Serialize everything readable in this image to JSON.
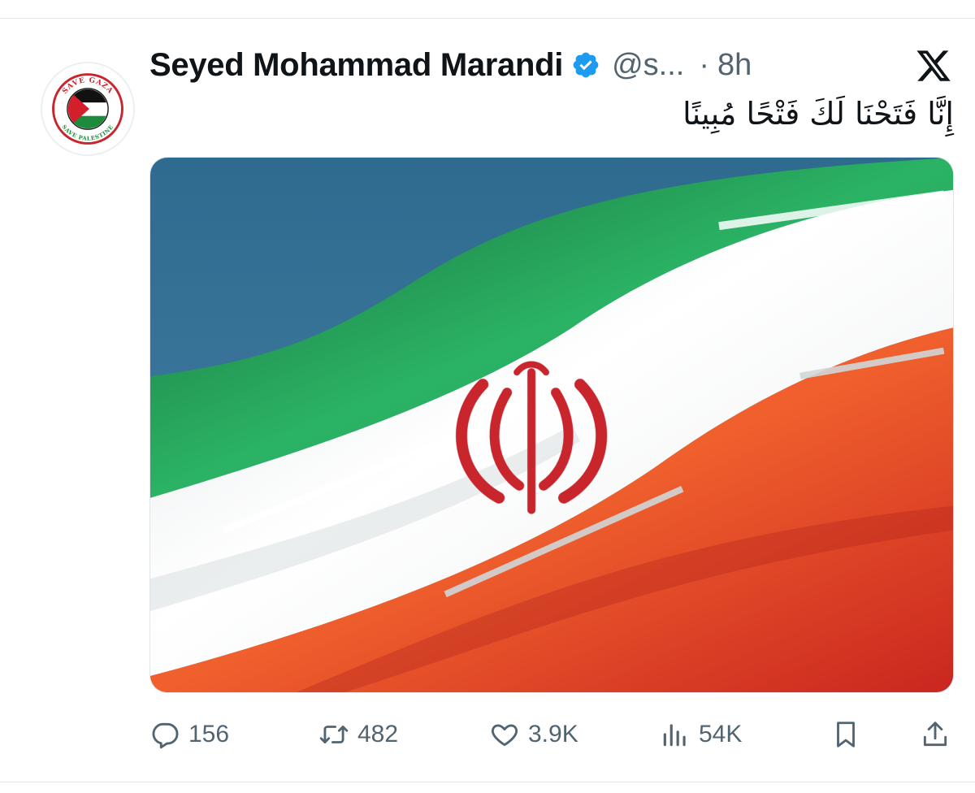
{
  "tweet": {
    "display_name": "Seyed Mohammad Marandi",
    "handle": "@s...",
    "separator": "·",
    "time": "8h",
    "text": "إِنَّا فَتَحْنَا لَكَ فَتْحًا مُبِينًا",
    "avatar": {
      "top_text": "SAVE GAZA",
      "bottom_text": "SAVE PALESTINE",
      "icon": "palestine-flag"
    },
    "media": {
      "description_icon": "iran-flag-photo",
      "emblem_color": "#c8262c",
      "colors": {
        "green": "#239f40",
        "white": "#ffffff",
        "red": "#da0000",
        "sky": "#3a6f93"
      }
    }
  },
  "actions": {
    "replies": {
      "icon": "reply-icon",
      "count": "156"
    },
    "reposts": {
      "icon": "repost-icon",
      "count": "482"
    },
    "likes": {
      "icon": "heart-icon",
      "count": "3.9K"
    },
    "views": {
      "icon": "views-icon",
      "count": "54K"
    },
    "bookmark": {
      "icon": "bookmark-icon"
    },
    "share": {
      "icon": "share-icon"
    }
  },
  "colors": {
    "text": "#0f1419",
    "secondary": "#536471",
    "verified": "#1d9bf0"
  }
}
